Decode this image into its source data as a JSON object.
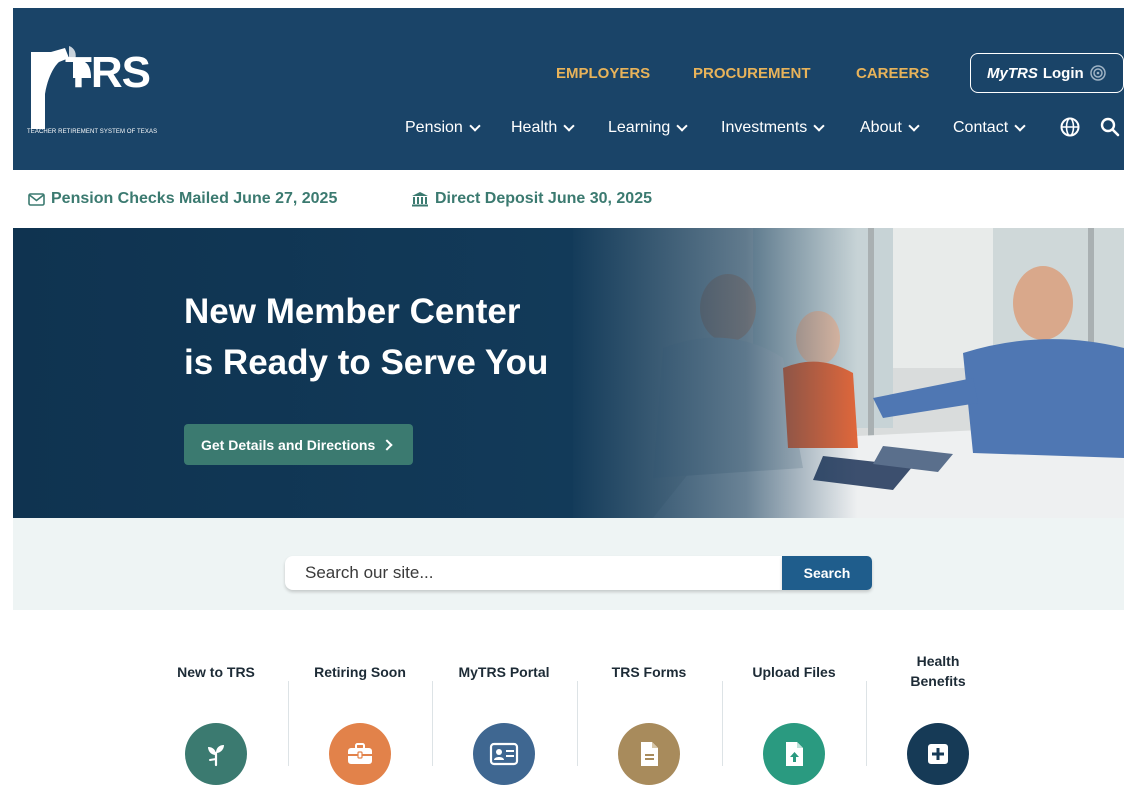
{
  "header": {
    "logo_text": "TRS",
    "logo_tagline": "TEACHER RETIREMENT SYSTEM OF TEXAS",
    "top_links": [
      "EMPLOYERS",
      "PROCUREMENT",
      "CAREERS"
    ],
    "login": {
      "brand": "MyTRS",
      "label": "Login"
    },
    "nav": [
      {
        "label": "Pension"
      },
      {
        "label": "Health"
      },
      {
        "label": "Learning"
      },
      {
        "label": "Investments"
      },
      {
        "label": "About"
      },
      {
        "label": "Contact"
      }
    ],
    "icons": [
      "globe-icon",
      "search-icon"
    ]
  },
  "notice": {
    "pension_checks": "Pension Checks Mailed June 27, 2025",
    "direct_deposit": "Direct Deposit June 30, 2025"
  },
  "hero": {
    "title_line1": "New Member Center",
    "title_line2": "is Ready to Serve You",
    "button_label": "Get Details and Directions"
  },
  "search": {
    "placeholder": "Search our site...",
    "button_label": "Search"
  },
  "quick_links": [
    {
      "label": "New to TRS",
      "icon": "sprout-icon",
      "color": "#3b7a70"
    },
    {
      "label": "Retiring Soon",
      "icon": "briefcase-icon",
      "color": "#e2824a"
    },
    {
      "label": "MyTRS Portal",
      "icon": "id-card-icon",
      "color": "#3f6791"
    },
    {
      "label": "TRS Forms",
      "icon": "document-icon",
      "color": "#a88b5c"
    },
    {
      "label": "Upload Files",
      "icon": "file-upload-icon",
      "color": "#2a9a80"
    },
    {
      "label": "Health Benefits",
      "icon": "plus-square-icon",
      "color": "#163a56"
    }
  ],
  "colors": {
    "header_bg": "#1a4468",
    "accent_gold": "#e8b35a",
    "teal": "#3b7a70",
    "search_btn": "#1f5d8c"
  }
}
